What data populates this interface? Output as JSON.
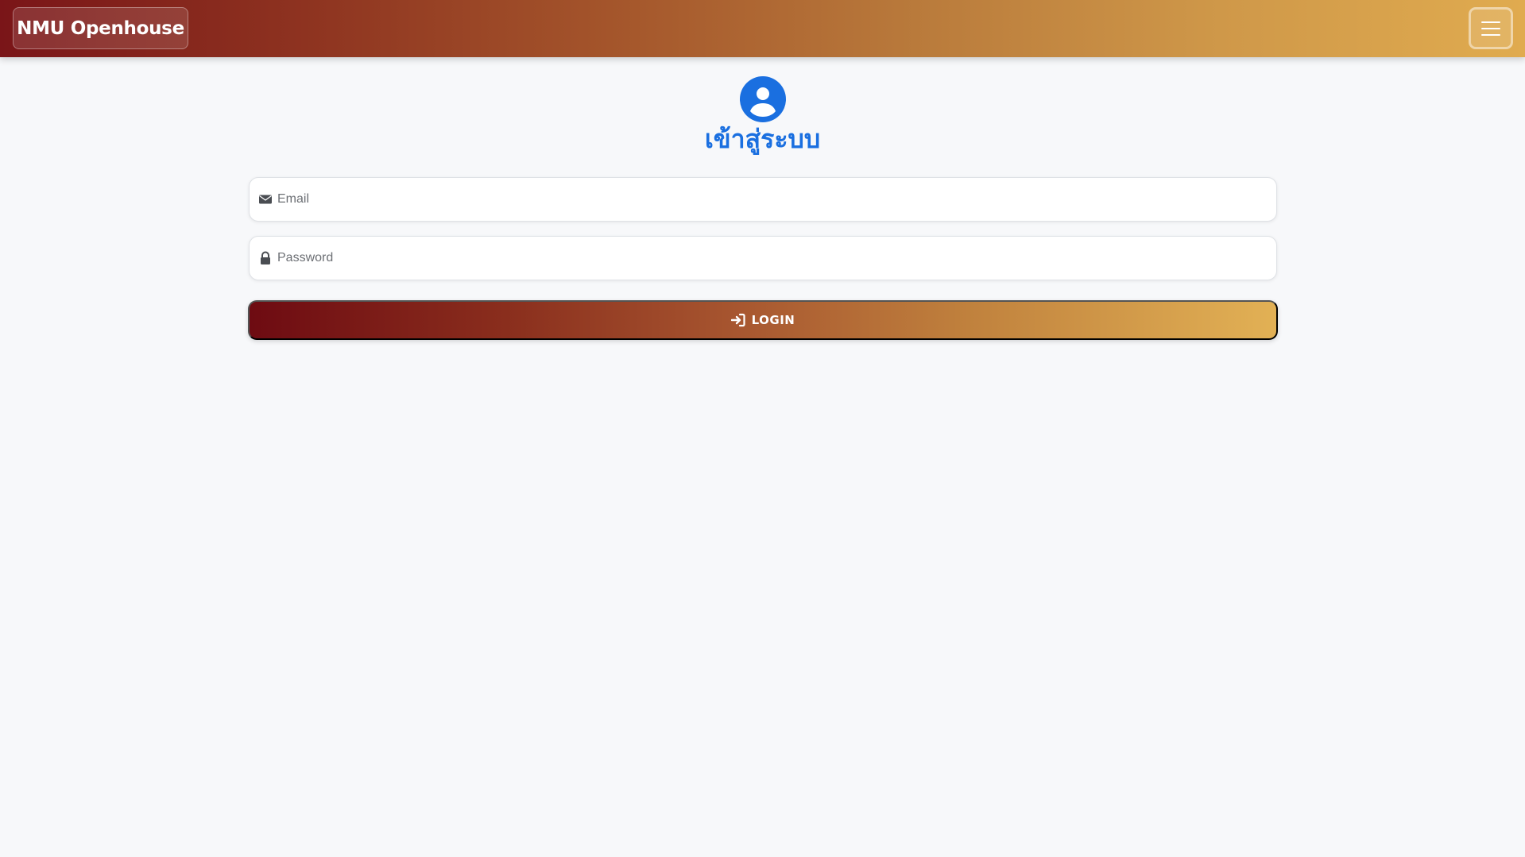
{
  "navbar": {
    "brand": "NMU Openhouse",
    "toggler_icon": "hamburger-menu-icon",
    "gradient_start": "#7a1518",
    "gradient_end": "#e0ab4f"
  },
  "login": {
    "header_icon": "user-circle-icon",
    "title": "เข้าสู่ระบบ",
    "title_color": "#1a6fe0",
    "email": {
      "icon": "envelope-icon",
      "placeholder": "Email",
      "value": ""
    },
    "password": {
      "icon": "lock-icon",
      "placeholder": "Password",
      "value": ""
    },
    "button": {
      "icon": "sign-in-icon",
      "label": "LOGIN"
    }
  }
}
